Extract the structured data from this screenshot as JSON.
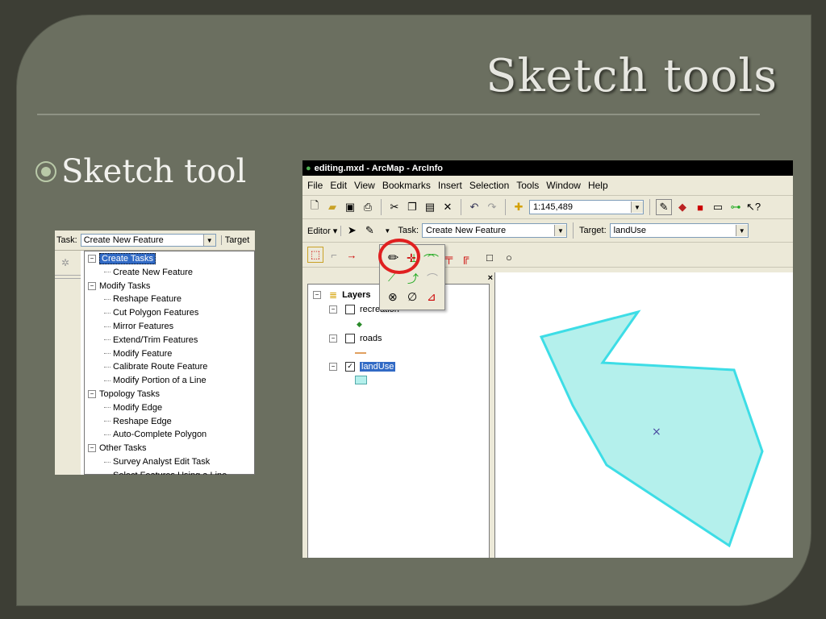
{
  "slide": {
    "title": "Sketch tools",
    "bullet": "Sketch tool"
  },
  "task_panel": {
    "task_label": "Task:",
    "task_value": "Create New Feature",
    "target_label": "Target",
    "tree": [
      {
        "label": "Create Tasks",
        "level": 0,
        "expand": "−",
        "selected": true
      },
      {
        "label": "Create New Feature",
        "level": 1
      },
      {
        "label": "Modify Tasks",
        "level": 0,
        "expand": "−"
      },
      {
        "label": "Reshape Feature",
        "level": 1
      },
      {
        "label": "Cut Polygon Features",
        "level": 1
      },
      {
        "label": "Mirror Features",
        "level": 1
      },
      {
        "label": "Extend/Trim Features",
        "level": 1
      },
      {
        "label": "Modify Feature",
        "level": 1
      },
      {
        "label": "Calibrate Route Feature",
        "level": 1
      },
      {
        "label": "Modify Portion of a Line",
        "level": 1
      },
      {
        "label": "Topology Tasks",
        "level": 0,
        "expand": "−"
      },
      {
        "label": "Modify Edge",
        "level": 1
      },
      {
        "label": "Reshape Edge",
        "level": 1
      },
      {
        "label": "Auto-Complete Polygon",
        "level": 1
      },
      {
        "label": "Other Tasks",
        "level": 0,
        "expand": "−"
      },
      {
        "label": "Survey Analyst Edit Task",
        "level": 1
      },
      {
        "label": "Select Features Using a Line",
        "level": 1
      }
    ]
  },
  "arcmap": {
    "window_title": "editing.mxd - ArcMap - ArcInfo",
    "menu": [
      "File",
      "Edit",
      "View",
      "Bookmarks",
      "Insert",
      "Selection",
      "Tools",
      "Window",
      "Help"
    ],
    "scale": "1:145,489",
    "editor_label": "Editor",
    "task_label": "Task:",
    "task_value": "Create New Feature",
    "target_label": "Target:",
    "target_value": "landUse",
    "toc_close": "×",
    "layers_label": "Layers",
    "layers": [
      {
        "name": "recreation",
        "checked": false
      },
      {
        "name": "roads",
        "checked": false
      },
      {
        "name": "landUse",
        "checked": true,
        "selected": true
      }
    ],
    "colors": {
      "polygon_fill": "#b4f0ec",
      "polygon_stroke": "#3ddde6",
      "highlight_ring": "#e02020",
      "selection": "#316ac5"
    },
    "map_point_marker": "×"
  }
}
